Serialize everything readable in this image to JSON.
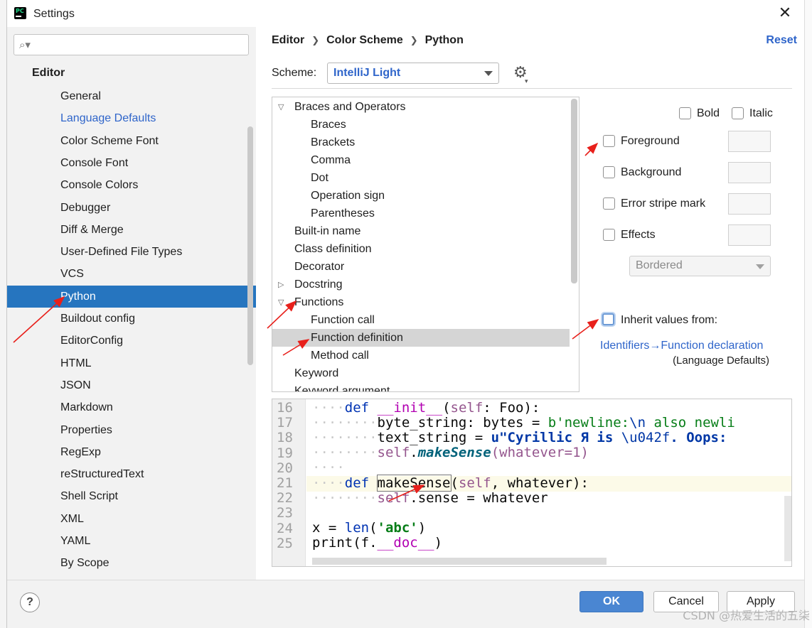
{
  "window": {
    "title": "Settings",
    "app_icon_text": "PC"
  },
  "search": {
    "placeholder": ""
  },
  "sidebar": {
    "group": "Editor",
    "items": [
      {
        "label": "General",
        "state": "normal"
      },
      {
        "label": "Language Defaults",
        "state": "link"
      },
      {
        "label": "Color Scheme Font",
        "state": "normal"
      },
      {
        "label": "Console Font",
        "state": "normal"
      },
      {
        "label": "Console Colors",
        "state": "normal"
      },
      {
        "label": "Debugger",
        "state": "normal"
      },
      {
        "label": "Diff & Merge",
        "state": "normal"
      },
      {
        "label": "User-Defined File Types",
        "state": "normal"
      },
      {
        "label": "VCS",
        "state": "normal"
      },
      {
        "label": "Python",
        "state": "selected"
      },
      {
        "label": "Buildout config",
        "state": "normal"
      },
      {
        "label": "EditorConfig",
        "state": "normal"
      },
      {
        "label": "HTML",
        "state": "normal"
      },
      {
        "label": "JSON",
        "state": "normal"
      },
      {
        "label": "Markdown",
        "state": "normal"
      },
      {
        "label": "Properties",
        "state": "normal"
      },
      {
        "label": "RegExp",
        "state": "normal"
      },
      {
        "label": "reStructuredText",
        "state": "normal"
      },
      {
        "label": "Shell Script",
        "state": "normal"
      },
      {
        "label": "XML",
        "state": "normal"
      },
      {
        "label": "YAML",
        "state": "normal"
      },
      {
        "label": "By Scope",
        "state": "normal"
      }
    ]
  },
  "breadcrumb": [
    "Editor",
    "Color Scheme",
    "Python"
  ],
  "reset_label": "Reset",
  "scheme": {
    "label": "Scheme:",
    "value": "IntelliJ Light"
  },
  "tree": [
    {
      "label": "Braces and Operators",
      "level": 0,
      "twisty": "expanded"
    },
    {
      "label": "Braces",
      "level": 1
    },
    {
      "label": "Brackets",
      "level": 1
    },
    {
      "label": "Comma",
      "level": 1
    },
    {
      "label": "Dot",
      "level": 1
    },
    {
      "label": "Operation sign",
      "level": 1
    },
    {
      "label": "Parentheses",
      "level": 1
    },
    {
      "label": "Built-in name",
      "level": 0
    },
    {
      "label": "Class definition",
      "level": 0
    },
    {
      "label": "Decorator",
      "level": 0
    },
    {
      "label": "Docstring",
      "level": 0,
      "twisty": "collapsed"
    },
    {
      "label": "Functions",
      "level": 0,
      "twisty": "expanded"
    },
    {
      "label": "Function call",
      "level": 1
    },
    {
      "label": "Function definition",
      "level": 1,
      "selected": true
    },
    {
      "label": "Method call",
      "level": 1
    },
    {
      "label": "Keyword",
      "level": 0
    },
    {
      "label": "Keyword argument",
      "level": 0
    }
  ],
  "props": {
    "bold": "Bold",
    "italic": "Italic",
    "foreground": "Foreground",
    "background": "Background",
    "error_stripe": "Error stripe mark",
    "effects": "Effects",
    "effects_type": "Bordered",
    "inherit": "Inherit values from:",
    "inherit_link": "Identifiers→Function declaration",
    "inherit_sub": "(Language Defaults)"
  },
  "code_lines": [
    "16",
    "17",
    "18",
    "19",
    "20",
    "21",
    "22",
    "23",
    "24",
    "25"
  ],
  "code": {
    "l16": {
      "ws": "····",
      "def": "def",
      "sp1": " ",
      "name": "__init__",
      "open": "(",
      "self": "self",
      "rest": ": Foo):"
    },
    "l17": {
      "ws": "········",
      "a": "byte_string: bytes = ",
      "str1": "b'newline:",
      "esc": "\\n",
      "str2": " also newli"
    },
    "l18": {
      "ws": "········",
      "a": "text_string = ",
      "str1": "u\"Cyrillic Я is ",
      "esc": "\\u042f",
      "str2": ". Oops: "
    },
    "l19": {
      "ws": "········",
      "self": "self",
      "dot": ".",
      "meth": "makeSense",
      "rest": "(whatever=1)"
    },
    "l20": {
      "ws": "····"
    },
    "l21": {
      "ws": "····",
      "def": "def",
      "sp1": " ",
      "name": "makeSense",
      "open": "(",
      "self": "self",
      "rest": ", whatever):"
    },
    "l22": {
      "ws": "········",
      "self": "self",
      "rest": ".sense = whatever"
    },
    "l24": {
      "a": "x = ",
      "fn": "len",
      "open": "(",
      "str": "'abc'",
      "close": ")"
    },
    "l25": {
      "fn": "print",
      "a": "(f.",
      "dun": "__doc__",
      "close": ")"
    }
  },
  "footer": {
    "help": "?",
    "ok": "OK",
    "cancel": "Cancel",
    "apply": "Apply"
  },
  "watermark": "CSDN @热爱生活的五柒",
  "colors": {
    "accent": "#2675bf",
    "link": "#2f65ca",
    "annotation_arrow": "#e8201b"
  }
}
